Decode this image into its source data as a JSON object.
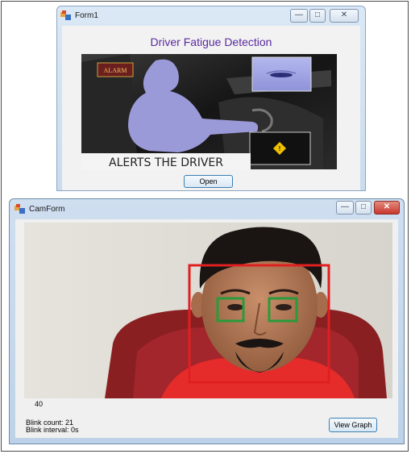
{
  "form1": {
    "title": "Form1",
    "heading": "Driver Fatigue Detection",
    "illustration": {
      "alarm_label": "ALARM",
      "caption": "ALERTS THE DRIVER"
    },
    "open_button": "Open"
  },
  "camform": {
    "title": "CamForm",
    "frame_value": "40",
    "blink_count": "Blink count: 21",
    "blink_interval": "Blink interval: 0s",
    "view_graph_button": "View Graph"
  },
  "colors": {
    "heading": "#5a2aa0",
    "face_box": "#e02020",
    "eye_box": "#2a9a3a",
    "close_button": "#c8372d"
  }
}
